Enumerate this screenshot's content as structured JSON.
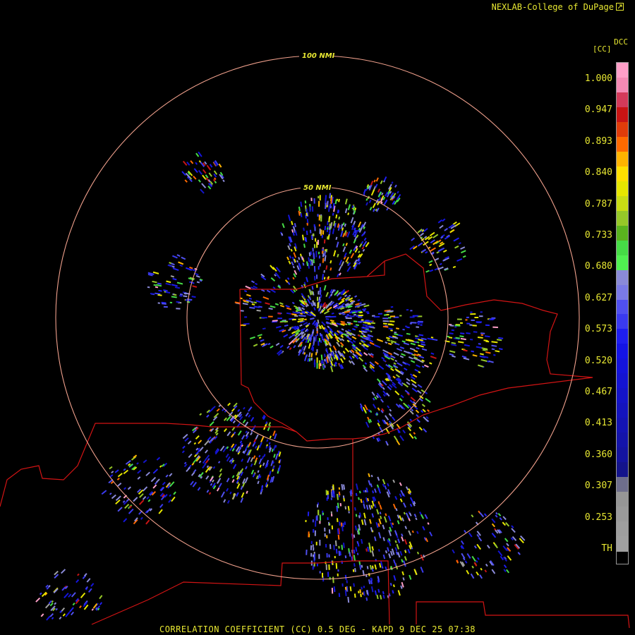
{
  "credit": "NEXLAB-College of DuPage",
  "caption": "CORRELATION COEFFICIENT (CC) 0.5 DEG - KAPD 9 DEC 25 07:38",
  "product_code": "DCC",
  "unit_label": "[CC]",
  "range_rings": [
    {
      "label": "50 NMI"
    },
    {
      "label": "100 NMI"
    }
  ],
  "colorbar": {
    "ticks": [
      "1.000",
      "0.947",
      "0.893",
      "0.840",
      "0.787",
      "0.733",
      "0.680",
      "0.627",
      "0.573",
      "0.520",
      "0.467",
      "0.413",
      "0.360",
      "0.307",
      "0.253",
      "TH"
    ],
    "colors": [
      "#ff9fc8",
      "#f58ab4",
      "#d43a5a",
      "#c81414",
      "#e03c0a",
      "#ff6a00",
      "#ffb400",
      "#ffe000",
      "#e6e600",
      "#c8dc14",
      "#96c828",
      "#5ab41e",
      "#46dc46",
      "#50f050",
      "#8a8ad8",
      "#7a7ae6",
      "#5050f0",
      "#3a3af0",
      "#1e1ef0",
      "#1414e6",
      "#1414dc",
      "#1414d2",
      "#1414c8",
      "#1414be",
      "#1414b4",
      "#1414aa",
      "#1414a0",
      "#14148c",
      "#6e6e8c",
      "#969696",
      "#9a9a9a",
      "#9e9e9e",
      "#a0a0a0"
    ]
  },
  "colors": {
    "ring": "#f0a08c",
    "border": "#d21414",
    "label": "#e8e832"
  }
}
